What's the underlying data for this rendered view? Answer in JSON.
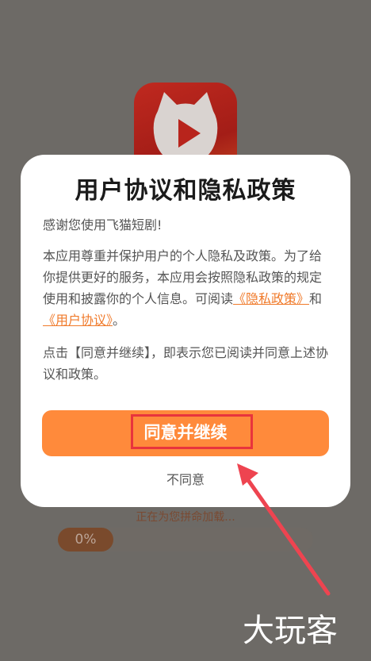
{
  "dialog": {
    "title": "用户协议和隐私政策",
    "greeting": "感谢您使用飞猫短剧!",
    "policy_text_1": "本应用尊重并保护用户的个人隐私及政策。为了给你提供更好的服务，本应用会按照隐私政策的规定使用和披露你的个人信息。可阅读",
    "privacy_link": "《隐私政策》",
    "and_text": "和",
    "user_agreement_link": "《用户协议》",
    "end_text": "。",
    "consent_text": "点击【同意并继续】，即表示您已阅读并同意上述协议和政策。",
    "agree_label": "同意并继续",
    "disagree_label": "不同意"
  },
  "loading": {
    "status_text": "正在为您拼命加载...",
    "progress_label": "0%",
    "progress_percent": 0
  },
  "watermark": "大玩客",
  "colors": {
    "accent": "#ff8a3b",
    "link": "#f07a2a",
    "highlight": "#e8343d",
    "logo": "#b8241c"
  }
}
